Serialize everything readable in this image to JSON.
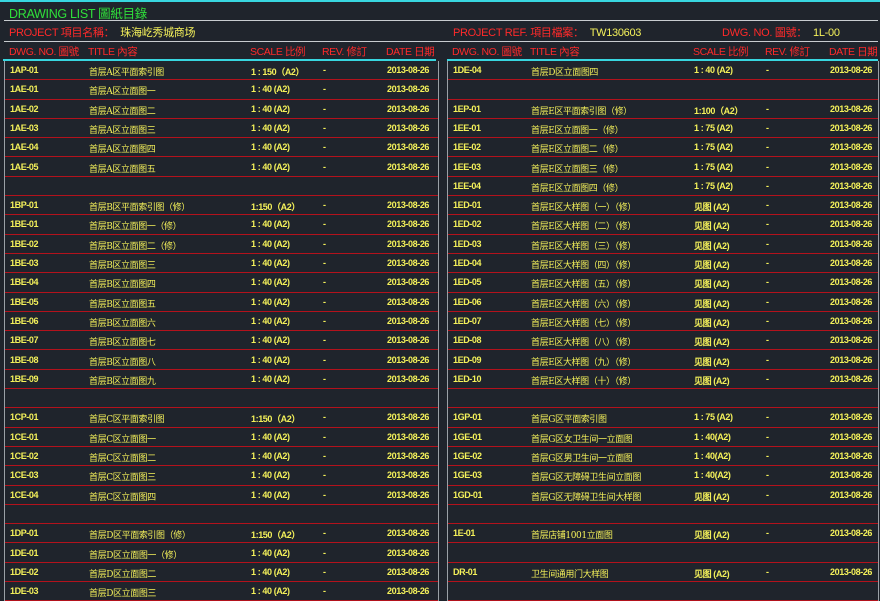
{
  "header": {
    "title": "DRAWING LIST 圖紙目錄",
    "project_label": "PROJECT  項目名稱：",
    "project_value": "珠海屹秀城商场",
    "project_ref_label": "PROJECT REF. 項目檔案：",
    "project_ref_value": "TW130603",
    "dwg_no_label": "DWG. NO. 圖號：",
    "dwg_no_value": "1L-00"
  },
  "columns": [
    "DWG. NO. 圖號",
    "TITLE 內容",
    "SCALE 比例",
    "REV. 修訂",
    "DATE 日期"
  ],
  "colors": {
    "accent": "#38d6e0",
    "label": "#ff2a2a",
    "value": "#f4f15a",
    "title": "#2fe03a",
    "row_line": "#b3121c"
  },
  "left_rows": [
    [
      "1AP-01",
      "首层A区平面索引图",
      "1 : 150（A2）",
      "-",
      "2013-08-26"
    ],
    [
      "1AE-01",
      "首层A区立面图一",
      "1 : 40 (A2)",
      "-",
      "2013-08-26"
    ],
    [
      "1AE-02",
      "首层A区立面图二",
      "1 : 40 (A2)",
      "-",
      "2013-08-26"
    ],
    [
      "1AE-03",
      "首层A区立面图三",
      "1 : 40 (A2)",
      "-",
      "2013-08-26"
    ],
    [
      "1AE-04",
      "首层A区立面图四",
      "1 : 40 (A2)",
      "-",
      "2013-08-26"
    ],
    [
      "1AE-05",
      "首层A区立面图五",
      "1 : 40 (A2)",
      "-",
      "2013-08-26"
    ],
    [],
    [
      "1BP-01",
      "首层B区平面索引图（修）",
      "1:150（A2）",
      "-",
      "2013-08-26"
    ],
    [
      "1BE-01",
      "首层B区立面图一（修）",
      "1 : 40 (A2)",
      "-",
      "2013-08-26"
    ],
    [
      "1BE-02",
      "首层B区立面图二（修）",
      "1 : 40 (A2)",
      "-",
      "2013-08-26"
    ],
    [
      "1BE-03",
      "首层B区立面图三",
      "1 : 40 (A2)",
      "-",
      "2013-08-26"
    ],
    [
      "1BE-04",
      "首层B区立面图四",
      "1 : 40 (A2)",
      "-",
      "2013-08-26"
    ],
    [
      "1BE-05",
      "首层B区立面图五",
      "1 : 40 (A2)",
      "-",
      "2013-08-26"
    ],
    [
      "1BE-06",
      "首层B区立面图六",
      "1 : 40 (A2)",
      "-",
      "2013-08-26"
    ],
    [
      "1BE-07",
      "首层B区立面图七",
      "1 : 40 (A2)",
      "-",
      "2013-08-26"
    ],
    [
      "1BE-08",
      "首层B区立面图八",
      "1 : 40 (A2)",
      "-",
      "2013-08-26"
    ],
    [
      "1BE-09",
      "首层B区立面图九",
      "1 : 40 (A2)",
      "-",
      "2013-08-26"
    ],
    [],
    [
      "1CP-01",
      "首层C区平面索引图",
      "1:150（A2）",
      "-",
      "2013-08-26"
    ],
    [
      "1CE-01",
      "首层C区立面图一",
      "1 : 40 (A2)",
      "-",
      "2013-08-26"
    ],
    [
      "1CE-02",
      "首层C区立面图二",
      "1 : 40 (A2)",
      "-",
      "2013-08-26"
    ],
    [
      "1CE-03",
      "首层C区立面图三",
      "1 : 40 (A2)",
      "-",
      "2013-08-26"
    ],
    [
      "1CE-04",
      "首层C区立面图四",
      "1 : 40 (A2)",
      "-",
      "2013-08-26"
    ],
    [],
    [
      "1DP-01",
      "首层D区平面索引图（修）",
      "1:150（A2）",
      "-",
      "2013-08-26"
    ],
    [
      "1DE-01",
      "首层D区立面图一（修）",
      "1 : 40 (A2)",
      "-",
      "2013-08-26"
    ],
    [
      "1DE-02",
      "首层D区立面图二",
      "1 : 40 (A2)",
      "-",
      "2013-08-26"
    ],
    [
      "1DE-03",
      "首层D区立面图三",
      "1 : 40 (A2)",
      "-",
      "2013-08-26"
    ]
  ],
  "right_rows": [
    [
      "1DE-04",
      "首层D区立面图四",
      "1 : 40 (A2)",
      "-",
      "2013-08-26"
    ],
    [],
    [
      "1EP-01",
      "首层E区平面索引图（修）",
      "1:100（A2）",
      "-",
      "2013-08-26"
    ],
    [
      "1EE-01",
      "首层E区立面图一（修）",
      "1 : 75 (A2)",
      "-",
      "2013-08-26"
    ],
    [
      "1EE-02",
      "首层E区立面图二（修）",
      "1 : 75 (A2)",
      "-",
      "2013-08-26"
    ],
    [
      "1EE-03",
      "首层E区立面图三（修）",
      "1 : 75 (A2)",
      "-",
      "2013-08-26"
    ],
    [
      "1EE-04",
      "首层E区立面图四（修）",
      "1 : 75 (A2)",
      "-",
      "2013-08-26"
    ],
    [
      "1ED-01",
      "首层E区大样图（一）（修）",
      "见图 (A2)",
      "-",
      "2013-08-26"
    ],
    [
      "1ED-02",
      "首层E区大样图（二）（修）",
      "见图 (A2)",
      "-",
      "2013-08-26"
    ],
    [
      "1ED-03",
      "首层E区大样图（三）（修）",
      "见图 (A2)",
      "-",
      "2013-08-26"
    ],
    [
      "1ED-04",
      "首层E区大样图（四）（修）",
      "见图 (A2)",
      "-",
      "2013-08-26"
    ],
    [
      "1ED-05",
      "首层E区大样图（五）（修）",
      "见图 (A2)",
      "-",
      "2013-08-26"
    ],
    [
      "1ED-06",
      "首层E区大样图（六）（修）",
      "见图 (A2)",
      "-",
      "2013-08-26"
    ],
    [
      "1ED-07",
      "首层E区大样图（七）（修）",
      "见图 (A2)",
      "-",
      "2013-08-26"
    ],
    [
      "1ED-08",
      "首层E区大样图（八）（修）",
      "见图 (A2)",
      "-",
      "2013-08-26"
    ],
    [
      "1ED-09",
      "首层E区大样图（九）（修）",
      "见图 (A2)",
      "-",
      "2013-08-26"
    ],
    [
      "1ED-10",
      "首层E区大样图（十）（修）",
      "见图 (A2)",
      "-",
      "2013-08-26"
    ],
    [],
    [
      "1GP-01",
      "首层G区平面索引图",
      "1 : 75 (A2)",
      "-",
      "2013-08-26"
    ],
    [
      "1GE-01",
      "首层G区女卫生间一立面图",
      "1 : 40(A2)",
      "-",
      "2013-08-26"
    ],
    [
      "1GE-02",
      "首层G区男卫生间一立面图",
      "1 : 40(A2)",
      "-",
      "2013-08-26"
    ],
    [
      "1GE-03",
      "首层G区无障碍卫生间立面图",
      "1 : 40(A2)",
      "-",
      "2013-08-26"
    ],
    [
      "1GD-01",
      "首层G区无障碍卫生间大样图",
      "见图 (A2)",
      "-",
      "2013-08-26"
    ],
    [],
    [
      "1E-01",
      "首层店铺1001立面图",
      "见图 (A2)",
      "-",
      "2013-08-26"
    ],
    [],
    [
      "DR-01",
      "卫生间通用门大样图",
      "见图 (A2)",
      "-",
      "2013-08-26"
    ],
    []
  ]
}
